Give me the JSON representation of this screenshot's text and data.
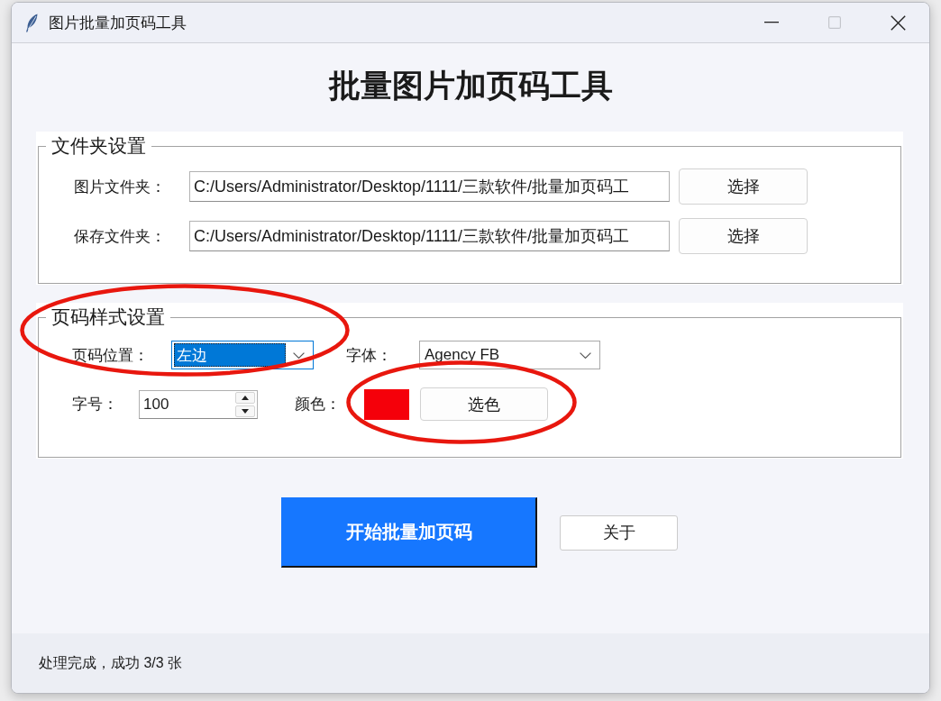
{
  "window": {
    "title": "图片批量加页码工具",
    "maximize_disabled": true
  },
  "heading": "批量图片加页码工具",
  "folder_settings": {
    "title": "文件夹设置",
    "rows": [
      {
        "label": "图片文件夹：",
        "path": "C:/Users/Administrator/Desktop/1111/三款软件/批量加页码工",
        "button": "选择"
      },
      {
        "label": "保存文件夹：",
        "path": "C:/Users/Administrator/Desktop/1111/三款软件/批量加页码工",
        "button": "选择"
      }
    ]
  },
  "page_style_settings": {
    "title": "页码样式设置",
    "position": {
      "label": "页码位置：",
      "value": "左边",
      "highlighted": true,
      "circled": true
    },
    "font": {
      "label": "字体：",
      "value": "Agency FB"
    },
    "size": {
      "label": "字号：",
      "value": "100"
    },
    "color": {
      "label": "颜色：",
      "color": "#f5000a",
      "button": "选色",
      "circled": true
    }
  },
  "actions": [
    {
      "kind": "primary",
      "label": "开始批量加页码"
    },
    {
      "kind": "secondary",
      "label": "关于"
    }
  ],
  "status_bar": "处理完成，成功 3/3 张"
}
